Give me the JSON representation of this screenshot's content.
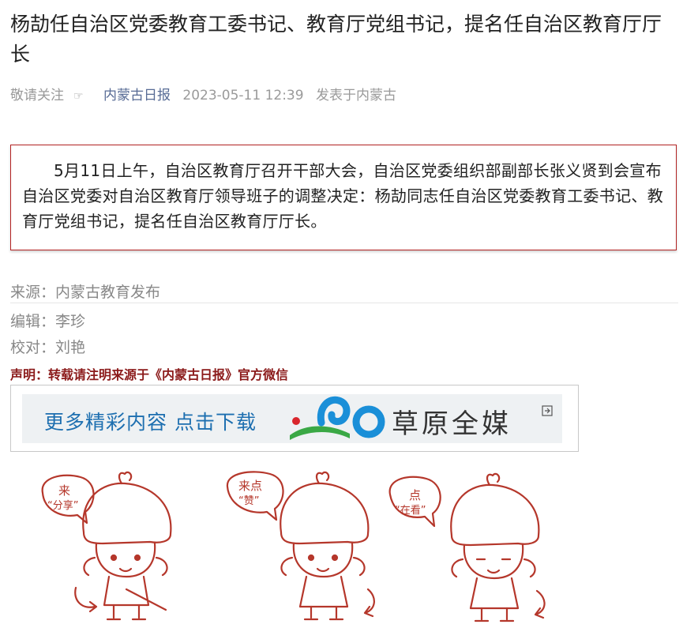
{
  "article": {
    "title": "杨劼任自治区党委教育工委书记、教育厅党组书记，提名任自治区教育厅厅长",
    "meta": {
      "follow": "敬请关注",
      "follow_icon": "☞",
      "account": "内蒙古日报",
      "datetime": "2023-05-11 12:39",
      "location": "发表于内蒙古"
    },
    "summary": "5月11日上午，自治区教育厅召开干部大会，自治区党委组织部副部长张义贤到会宣布自治区党委对自治区教育厅领导班子的调整决定：杨劼同志任自治区党委教育工委书记、教育厅党组书记，提名任自治区教育厅厅长。",
    "source": "来源：内蒙古教育发布",
    "editor": "编辑：李珍",
    "proofreader": "校对：刘艳",
    "notice": "声明：转载请注明来源于《内蒙古日报》官方微信"
  },
  "banner": {
    "text": "更多精彩内容 点击下载",
    "brand": "草原全媒",
    "colors": {
      "text": "#1d6fb0",
      "logo_blue": "#1a8fd8",
      "logo_green": "#3aa845",
      "logo_red": "#d9262c"
    }
  },
  "mascots": [
    {
      "bubble_line1": "来",
      "bubble_line2": "“分享”"
    },
    {
      "bubble_line1": "来点",
      "bubble_line2": "“赞”"
    },
    {
      "bubble_line1": "点",
      "bubble_line2": "“在看”"
    }
  ],
  "colors": {
    "accent_red": "#b22222",
    "link_blue": "#576b95",
    "mascot_red": "#b5372b"
  }
}
